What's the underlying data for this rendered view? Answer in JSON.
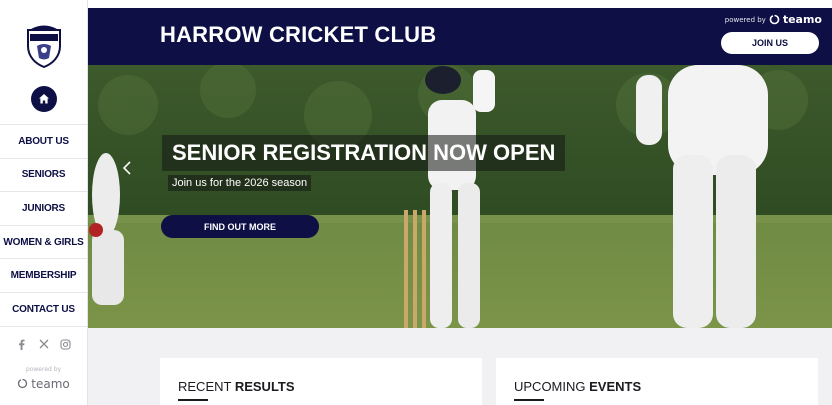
{
  "sidebar": {
    "crest_icon": "club-crest-icon",
    "home_icon": "home-icon",
    "nav": [
      {
        "label": "ABOUT US"
      },
      {
        "label": "SENIORS"
      },
      {
        "label": "JUNIORS"
      },
      {
        "label": "WOMEN & GIRLS"
      },
      {
        "label": "MEMBERSHIP"
      },
      {
        "label": "CONTACT US"
      }
    ],
    "social_icons": [
      "facebook-icon",
      "x-icon",
      "instagram-icon"
    ],
    "powered_by": "powered by",
    "brand": "teamo"
  },
  "header": {
    "title": "HARROW CRICKET CLUB",
    "powered_by": "powered by",
    "brand": "teamo",
    "join_label": "JOIN US"
  },
  "hero": {
    "title": "SENIOR REGISTRATION NOW OPEN",
    "subtitle": "Join us for the 2026 season",
    "cta_label": "FIND OUT MORE",
    "prev_icon": "chevron-left-icon"
  },
  "sections": [
    {
      "title_light": "RECENT ",
      "title_bold": "RESULTS"
    },
    {
      "title_light": "UPCOMING ",
      "title_bold": "EVENTS"
    }
  ],
  "colors": {
    "brand_navy": "#0d0f45",
    "white": "#ffffff",
    "section_bg": "#f1f1f3"
  }
}
